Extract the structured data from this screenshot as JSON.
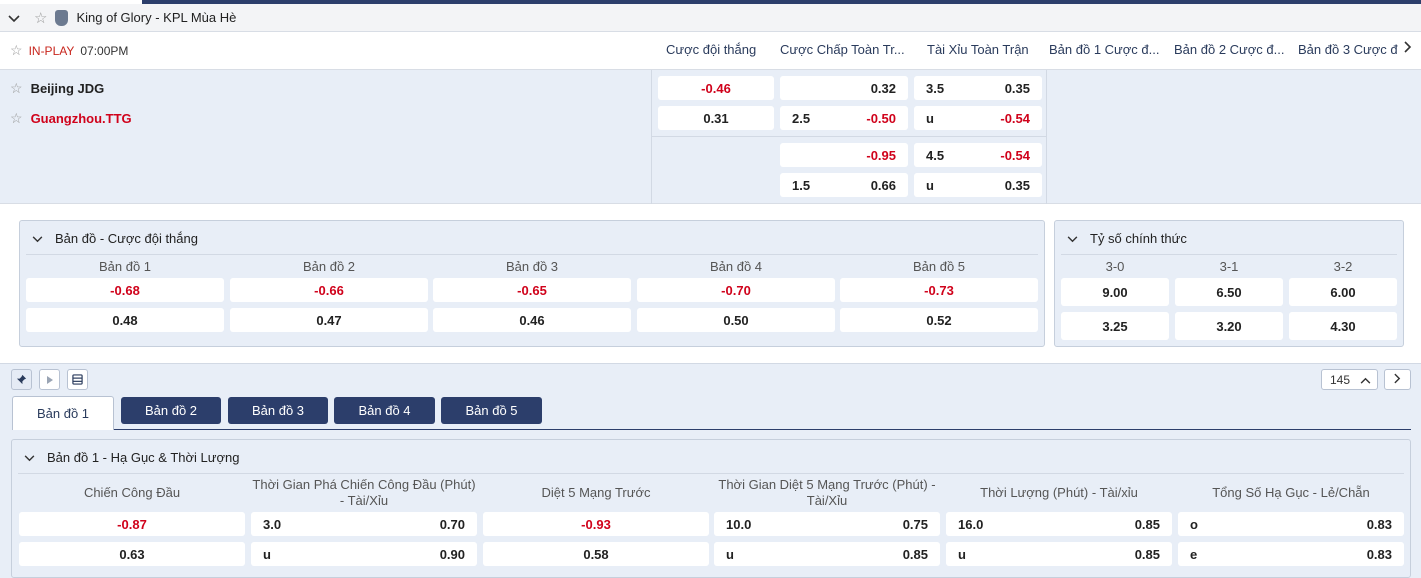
{
  "league": {
    "name": "King of Glory - KPL Mùa Hè"
  },
  "match": {
    "status": "IN-PLAY",
    "time": "07:00PM",
    "home": "Beijing JDG",
    "away": "Guangzhou.TTG"
  },
  "columns": [
    "Cược đội thắng",
    "Cược Chấp Toàn Tr...",
    "Tài Xỉu Toàn Trận",
    "Bản đồ 1 Cược đ...",
    "Bản đồ 2 Cược đ...",
    "Bản đồ 3 Cược đ..."
  ],
  "odds": {
    "moneyline": [
      "-0.46",
      "0.31"
    ],
    "handicap": [
      {
        "line": "",
        "odd": "0.32"
      },
      {
        "line": "2.5",
        "odd": "-0.50"
      },
      {
        "line": "",
        "odd": "-0.95"
      },
      {
        "line": "1.5",
        "odd": "0.66"
      }
    ],
    "overunder": [
      {
        "line": "3.5",
        "odd": "0.35"
      },
      {
        "line": "u",
        "odd": "-0.54"
      },
      {
        "line": "4.5",
        "odd": "-0.54"
      },
      {
        "line": "u",
        "odd": "0.35"
      }
    ]
  },
  "map_winner": {
    "title": "Bản đồ - Cược đội thắng",
    "maps": [
      {
        "name": "Bản đồ 1",
        "home": "-0.68",
        "away": "0.48"
      },
      {
        "name": "Bản đồ 2",
        "home": "-0.66",
        "away": "0.47"
      },
      {
        "name": "Bản đồ 3",
        "home": "-0.65",
        "away": "0.46"
      },
      {
        "name": "Bản đồ 4",
        "home": "-0.70",
        "away": "0.50"
      },
      {
        "name": "Bản đồ 5",
        "home": "-0.73",
        "away": "0.52"
      }
    ]
  },
  "correct_score": {
    "title": "Tỷ số chính thức",
    "scores": [
      {
        "label": "3-0",
        "home": "9.00",
        "away": "3.25"
      },
      {
        "label": "3-1",
        "home": "6.50",
        "away": "3.20"
      },
      {
        "label": "3-2",
        "home": "6.00",
        "away": "4.30"
      }
    ]
  },
  "pager": {
    "count": "145"
  },
  "tabs": [
    "Bản đồ 1",
    "Bản đồ 2",
    "Bản đồ 3",
    "Bản đồ 4",
    "Bản đồ 5"
  ],
  "map1": {
    "title": "Bản đồ 1 - Hạ Gục & Thời Lượng",
    "markets": [
      {
        "head": "Chiến Công Đầu",
        "rows": [
          {
            "line": "",
            "odd": "-0.87"
          },
          {
            "line": "",
            "odd": "0.63"
          }
        ]
      },
      {
        "head": "Thời Gian Phá Chiến Công Đầu (Phút) - Tài/Xỉu",
        "rows": [
          {
            "line": "3.0",
            "odd": "0.70"
          },
          {
            "line": "u",
            "odd": "0.90"
          }
        ]
      },
      {
        "head": "Diệt 5 Mạng Trước",
        "rows": [
          {
            "line": "",
            "odd": "-0.93"
          },
          {
            "line": "",
            "odd": "0.58"
          }
        ]
      },
      {
        "head": "Thời Gian Diệt 5 Mạng Trước (Phút) - Tài/Xỉu",
        "rows": [
          {
            "line": "10.0",
            "odd": "0.75"
          },
          {
            "line": "u",
            "odd": "0.85"
          }
        ]
      },
      {
        "head": "Thời Lượng (Phút) - Tài/xỉu",
        "rows": [
          {
            "line": "16.0",
            "odd": "0.85"
          },
          {
            "line": "u",
            "odd": "0.85"
          }
        ]
      },
      {
        "head": "Tổng Số Hạ Gục - Lẻ/Chẵn",
        "rows": [
          {
            "line": "o",
            "odd": "0.83"
          },
          {
            "line": "e",
            "odd": "0.83"
          }
        ]
      }
    ]
  },
  "colors": {
    "negative": "#d0021b",
    "navy": "#2c3e6b",
    "panel": "#e8eef7"
  }
}
